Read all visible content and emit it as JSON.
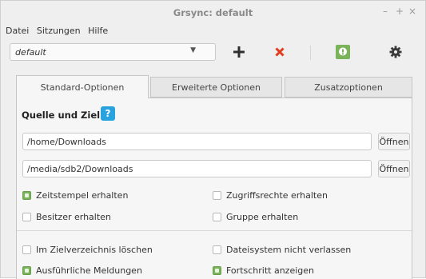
{
  "window": {
    "title": "Grsync: default",
    "controls": {
      "minimize": "–",
      "maximize": "+",
      "close": "×"
    }
  },
  "menu": [
    "Datei",
    "Sitzungen",
    "Hilfe"
  ],
  "toolbar": {
    "session_value": "default",
    "icons": [
      "add-session-icon",
      "delete-session-icon",
      "simulate-icon",
      "settings-gear-icon"
    ],
    "colors": {
      "add": "#2f2f2f",
      "delete": "#e23b1e",
      "simulate": "#7ab35a",
      "gear": "#3a3a3a"
    }
  },
  "tabs": [
    {
      "label": "Standard-Optionen",
      "active": true
    },
    {
      "label": "Erweiterte Optionen",
      "active": false
    },
    {
      "label": "Zusatzoptionen",
      "active": false
    }
  ],
  "panel": {
    "section_title": "Quelle und Ziel:",
    "source_path": "/home/Downloads",
    "destination_path": "/media/sdb2/Downloads",
    "open_label_1": "Öffnen",
    "open_label_2": "Öffnen",
    "options": {
      "preserve_time": {
        "label": "Zeitstempel erhalten",
        "checked": true
      },
      "preserve_perms": {
        "label": "Zugriffsrechte erhalten",
        "checked": false
      },
      "preserve_owner": {
        "label": "Besitzer erhalten",
        "checked": false
      },
      "preserve_group": {
        "label": "Gruppe erhalten",
        "checked": false
      },
      "delete_dest": {
        "label": "Im Zielverzeichnis löschen",
        "checked": false
      },
      "one_fs": {
        "label": "Dateisystem nicht verlassen",
        "checked": false
      },
      "verbose": {
        "label": "Ausführliche Meldungen",
        "checked": true
      },
      "progress": {
        "label": "Fortschritt anzeigen",
        "checked": true
      }
    }
  }
}
